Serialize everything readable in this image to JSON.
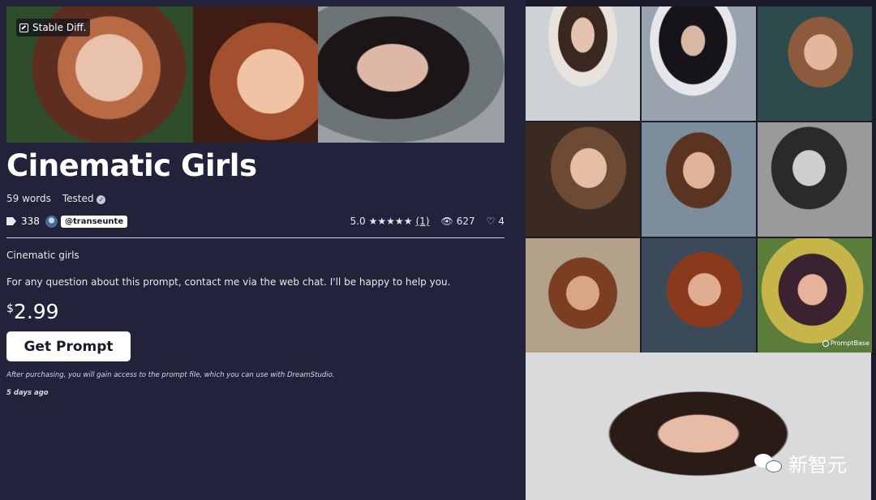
{
  "badge": {
    "label": "Stable Diff."
  },
  "title": "Cinematic Girls",
  "meta": {
    "words": "59 words",
    "tested": "Tested"
  },
  "stats": {
    "tags": "338",
    "author": "@transeunte",
    "rating": "5.0",
    "stars": "★★★★★",
    "reviews": "(1)",
    "views": "627",
    "likes": "4"
  },
  "description": {
    "line1": "Cinematic girls",
    "line2": "For any question about this prompt, contact me via the web chat. I'll be happy to help you."
  },
  "price": {
    "currency": "$",
    "amount": "2.99"
  },
  "cta": {
    "label": "Get Prompt"
  },
  "note": "After purchasing, you will gain access to the prompt file, which you can use with DreamStudio.",
  "posted": "5 days ago",
  "gallery": {
    "watermark": "PromptBase"
  },
  "wechat": {
    "label": "新智元"
  }
}
